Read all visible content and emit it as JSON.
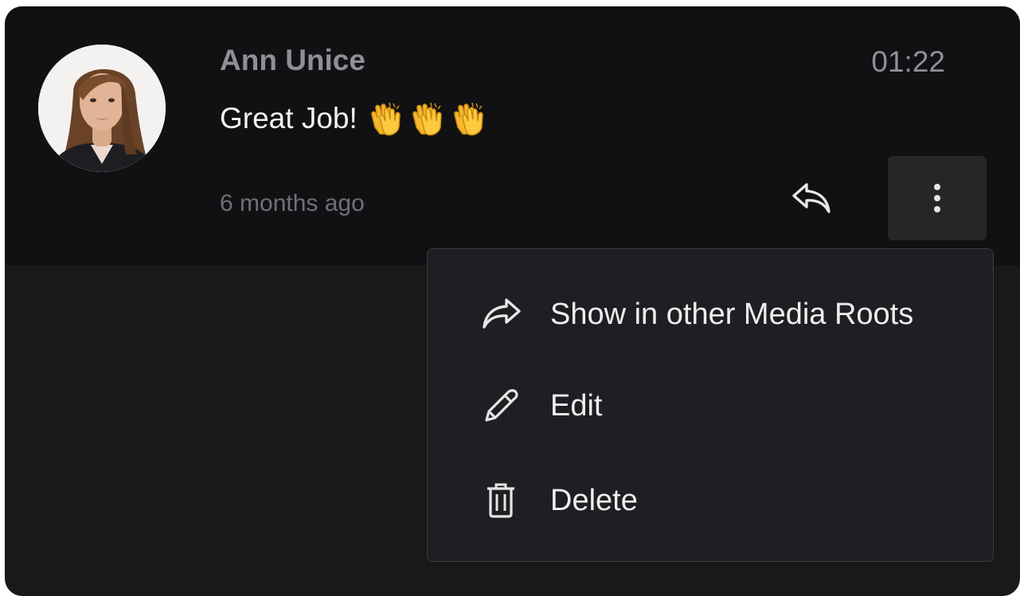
{
  "comment": {
    "author": "Ann Unice",
    "time": "01:22",
    "message": "Great Job!",
    "message_emoji": [
      "clapping-hands",
      "clapping-hands",
      "clapping-hands"
    ],
    "relative_time": "6 months ago",
    "icons": {
      "reply": "reply-icon",
      "more": "more-vertical-icon"
    }
  },
  "menu": {
    "items": [
      {
        "label": "Show in other Media Roots",
        "icon": "share-forward-icon"
      },
      {
        "label": "Edit",
        "icon": "pencil-icon"
      },
      {
        "label": "Delete",
        "icon": "trash-icon"
      }
    ]
  },
  "colors": {
    "panel_bg": "#19191b",
    "comment_bg": "#111113",
    "menu_bg": "#1e1f22",
    "menu_border": "#3b3c40",
    "text_primary": "#f1f1f1",
    "text_muted": "#8e9096"
  }
}
